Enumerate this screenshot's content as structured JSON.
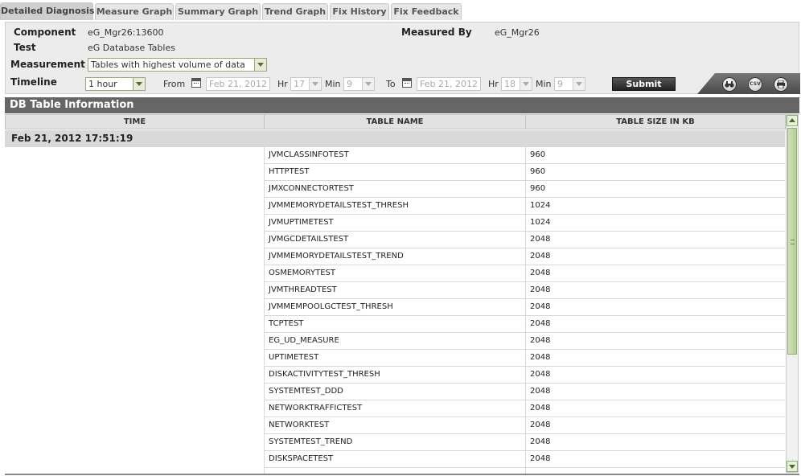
{
  "tabs": [
    {
      "label": "Detailed Diagnosis",
      "active": true
    },
    {
      "label": "Measure Graph"
    },
    {
      "label": "Summary Graph"
    },
    {
      "label": "Trend Graph"
    },
    {
      "label": "Fix History"
    },
    {
      "label": "Fix Feedback"
    }
  ],
  "form": {
    "component_label": "Component",
    "component_value": "eG_Mgr26:13600",
    "measured_by_label": "Measured By",
    "measured_by_value": "eG_Mgr26",
    "test_label": "Test",
    "test_value": "eG Database Tables",
    "measurement_label": "Measurement",
    "measurement_value": "Tables with highest volume of data",
    "timeline_label": "Timeline",
    "timeline_value": "1 hour",
    "from_label": "From",
    "from_date": "Feb 21, 2012",
    "from_hr_label": "Hr",
    "from_hr": "17",
    "from_min_label": "Min",
    "from_min": "9",
    "to_label": "To",
    "to_date": "Feb 21, 2012",
    "to_hr_label": "Hr",
    "to_hr": "18",
    "to_min_label": "Min",
    "to_min": "9",
    "submit_label": "Submit"
  },
  "toolbar": {
    "search_icon": "binoculars-icon",
    "csv_label": "CSV",
    "print_icon": "printer-icon"
  },
  "section": {
    "title": "DB Table Information",
    "columns": [
      "TIME",
      "TABLE NAME",
      "TABLE SIZE IN KB"
    ],
    "group_time": "Feb 21, 2012 17:51:19",
    "rows": [
      {
        "name": "JVMCLASSINFOTEST",
        "size": "960"
      },
      {
        "name": "HTTPTEST",
        "size": "960"
      },
      {
        "name": "JMXCONNECTORTEST",
        "size": "960"
      },
      {
        "name": "JVMMEMORYDETAILSTEST_THRESH",
        "size": "1024"
      },
      {
        "name": "JVMUPTIMETEST",
        "size": "1024"
      },
      {
        "name": "JVMGCDETAILSTEST",
        "size": "2048"
      },
      {
        "name": "JVMMEMORYDETAILSTEST_TREND",
        "size": "2048"
      },
      {
        "name": "OSMEMORYTEST",
        "size": "2048"
      },
      {
        "name": "JVMTHREADTEST",
        "size": "2048"
      },
      {
        "name": "JVMMEMPOOLGCTEST_THRESH",
        "size": "2048"
      },
      {
        "name": "TCPTEST",
        "size": "2048"
      },
      {
        "name": "EG_UD_MEASURE",
        "size": "2048"
      },
      {
        "name": "UPTIMETEST",
        "size": "2048"
      },
      {
        "name": "DISKACTIVITYTEST_THRESH",
        "size": "2048"
      },
      {
        "name": "SYSTEMTEST_DDD",
        "size": "2048"
      },
      {
        "name": "NETWORKTRAFFICTEST",
        "size": "2048"
      },
      {
        "name": "NETWORKTEST",
        "size": "2048"
      },
      {
        "name": "SYSTEMTEST_TREND",
        "size": "2048"
      },
      {
        "name": "DISKSPACETEST",
        "size": "2048"
      },
      {
        "name": "",
        "size": ""
      }
    ]
  }
}
